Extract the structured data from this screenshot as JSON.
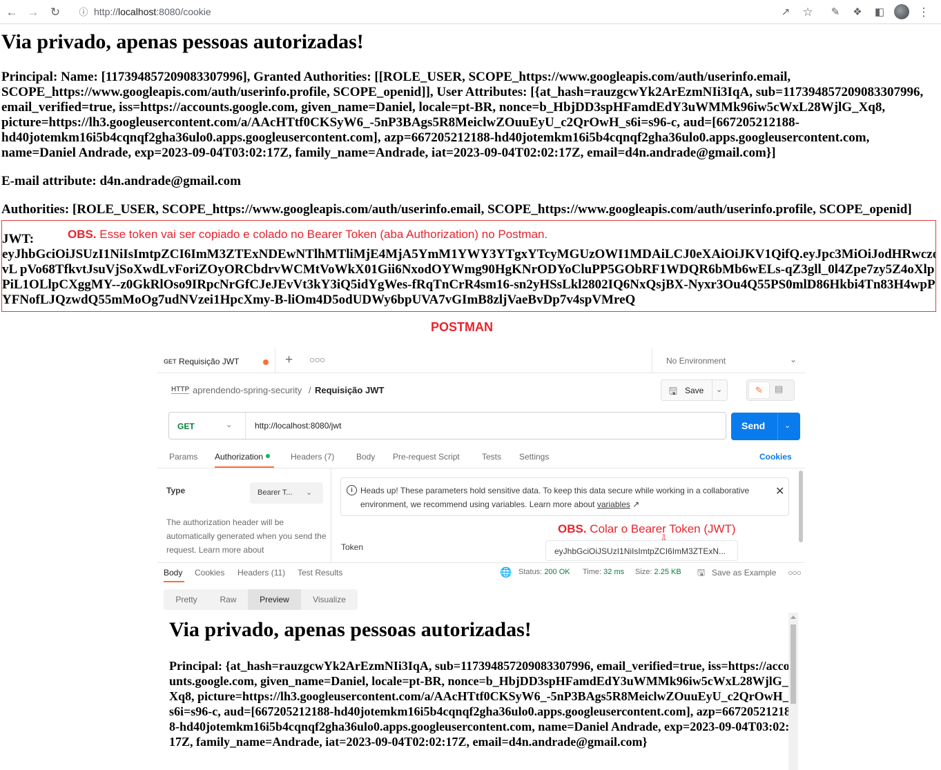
{
  "browser": {
    "url_prefix": "http://",
    "url_host": "localhost",
    "url_rest": ":8080/cookie",
    "icons": [
      "back-arrow",
      "forward-arrow",
      "reload",
      "info-circle",
      "share",
      "star",
      "puzzle-extension",
      "sidebar-panel",
      "avatar",
      "kebab-menu"
    ]
  },
  "page": {
    "title": "Via privado, apenas pessoas autorizadas!",
    "principal": "Principal: Name: [117394857209083307996], Granted Authorities: [[ROLE_USER, SCOPE_https://www.googleapis.com/auth/userinfo.email, SCOPE_https://www.googleapis.com/auth/userinfo.profile, SCOPE_openid]], User Attributes: [{at_hash=rauzgcwYk2ArEzmNIi3IqA, sub=117394857209083307996, email_verified=true, iss=https://accounts.google.com, given_name=Daniel, locale=pt-BR, nonce=b_HbjDD3spHFamdEdY3uWMMk96iw5cWxL28WjlG_Xq8, picture=https://lh3.googleusercontent.com/a/AAcHTtf0CKSyW6_-5nP3BAgs5R8MeiclwZOuuEyU_c2QrOwH_s6i=s96-c, aud=[667205212188-hd40jotemkm16i5b4cqnqf2gha36ulo0.apps.googleusercontent.com], azp=667205212188-hd40jotemkm16i5b4cqnqf2gha36ulo0.apps.googleusercontent.com, name=Daniel Andrade, exp=2023-09-04T03:02:17Z, family_name=Andrade, iat=2023-09-04T02:02:17Z, email=d4n.andrade@gmail.com}]",
    "email_attr": "E-mail attribute: d4n.andrade@gmail.com",
    "authorities": "Authorities: [ROLE_USER, SCOPE_https://www.googleapis.com/auth/userinfo.email, SCOPE_https://www.googleapis.com/auth/userinfo.profile, SCOPE_openid]",
    "jwt_label": "JWT:",
    "jwt_token": "eyJhbGciOiJSUzI1NiIsImtpZCI6ImM3ZTExNDEwNTlhMTliMjE4MjA5YmM1YWY3YTgxYTcyMGUzOWI1MDAiLCJ0eXAiOiJKV1QifQ.eyJpc3MiOiJodHRwczovL pVo68TfkvtJsuVjSoXwdLvForiZOyORCbdrvWCMtVoWkX01Gii6NxodOYWmg90HgKNrODYoCluPP5GObRF1WDQR6bMb6wELs-qZ3gll_0l4Zpe7zy5Z4oXlpPiL1OLlpCXggMY--z0GkRlOso9IRpcNrGfCJeJEvVt3kY3iQ5idYgWes-fRqTnCrR4sm16-sn2yHSsLkl2802IQ6NxQsjBX-Nyxr3Ou4Q55PS0mlD86Hkbi4Tn83H4wpPfYFNofLJQzwdQ55mMoOg7udNVzei1HpcXmy-B-liOm4D5odUDWy6bpUVA7vGImB8zljVaeBvDp7v4spVMreQ"
  },
  "annotations": {
    "obs_label": "OBS.",
    "obs1_text": " Esse token vai ser copiado e colado no Bearer Token (aba Authorization) no Postman.",
    "postman_title": "POSTMAN",
    "obs2_text": " Colar o Bearer Token (JWT)"
  },
  "postman": {
    "tab": {
      "method": "GET",
      "name": "Requisição JWT"
    },
    "environment": "No Environment",
    "breadcrumb": {
      "icon_text": "HTTP",
      "collection": "aprendendo-spring-security",
      "separator": "/",
      "request": "Requisição JWT"
    },
    "save_label": "Save",
    "method": "GET",
    "url": "http://localhost:8080/jwt",
    "send_label": "Send",
    "request_tabs": [
      "Params",
      "Authorization",
      "Headers (7)",
      "Body",
      "Pre-request Script",
      "Tests",
      "Settings"
    ],
    "cookies_label": "Cookies",
    "type_label": "Type",
    "type_value": "Bearer T...",
    "auth_desc": "The authorization header will be automatically generated when you send the request. Learn more about",
    "notice_text": "Heads up! These parameters hold sensitive data. To keep this data secure while working in a collaborative environment, we recommend using variables. Learn more about ",
    "notice_link": "variables",
    "notice_link_arrow": "↗",
    "token_label": "Token",
    "token_value": "eyJhbGciOiJSUzI1NiIsImtpZCI6ImM3ZTExN...",
    "response_tabs": [
      "Body",
      "Cookies",
      "Headers (11)",
      "Test Results"
    ],
    "status_label": "Status:",
    "status_value": "200 OK",
    "time_label": "Time:",
    "time_value": "32 ms",
    "size_label": "Size:",
    "size_value": "2.25 KB",
    "save_example": "Save as Example",
    "view_modes": [
      "Pretty",
      "Raw",
      "Preview",
      "Visualize"
    ],
    "active_view": "Preview",
    "preview_title": "Via privado, apenas pessoas autorizadas!",
    "preview_principal": "Principal: {at_hash=rauzgcwYk2ArEzmNIi3IqA, sub=117394857209083307996, email_verified=true, iss=https://accounts.google.com, given_name=Daniel, locale=pt-BR, nonce=b_HbjDD3spHFamdEdY3uWMMk96iw5cWxL28WjlG_Xq8, picture=https://lh3.googleusercontent.com/a/AAcHTtf0CKSyW6_-5nP3BAgs5R8MeiclwZOuuEyU_c2QrOwH_s6i=s96-c, aud=[667205212188-hd40jotemkm16i5b4cqnqf2gha36ulo0.apps.googleusercontent.com], azp=667205212188-hd40jotemkm16i5b4cqnqf2gha36ulo0.apps.googleusercontent.com, name=Daniel Andrade, exp=2023-09-04T03:02:17Z, family_name=Andrade, iat=2023-09-04T02:02:17Z, email=d4n.andrade@gmail.com}"
  },
  "colors": {
    "annotation_red": "#e8242c",
    "postman_orange": "#ff6c37",
    "send_blue": "#097bed",
    "status_green": "#0a7b3e"
  }
}
